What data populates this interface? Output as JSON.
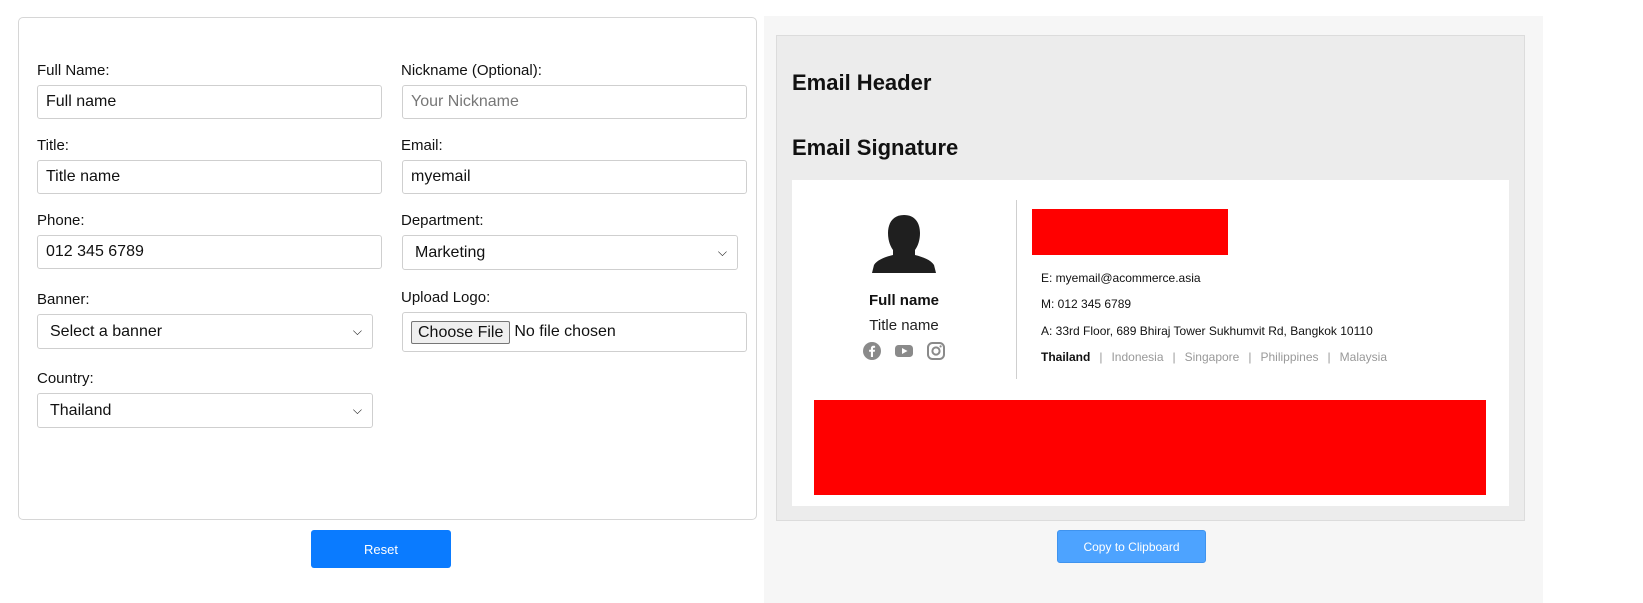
{
  "form": {
    "full_name": {
      "label": "Full Name:",
      "value": "Full name"
    },
    "nickname": {
      "label": "Nickname (Optional):",
      "placeholder": "Your Nickname"
    },
    "title": {
      "label": "Title:",
      "value": "Title name"
    },
    "email": {
      "label": "Email:",
      "value": "myemail"
    },
    "phone": {
      "label": "Phone:",
      "value": "012 345 6789"
    },
    "department": {
      "label": "Department:",
      "selected": "Marketing"
    },
    "banner": {
      "label": "Banner:",
      "selected": "Select a banner"
    },
    "logo": {
      "label": "Upload Logo:",
      "button": "Choose File",
      "status": "No file chosen"
    },
    "country": {
      "label": "Country:",
      "selected": "Thailand"
    },
    "reset_label": "Reset"
  },
  "preview": {
    "header_title": "Email Header",
    "signature_title": "Email Signature",
    "name": "Full name",
    "title": "Title name",
    "email_line": "E: myemail@acommerce.asia",
    "mobile_line": "M: 012 345 6789",
    "address_line": "A: 33rd Floor, 689 Bhiraj Tower Sukhumvit Rd, Bangkok 10110",
    "countries": [
      "Thailand",
      "Indonesia",
      "Singapore",
      "Philippines",
      "Malaysia"
    ],
    "active_country": "Thailand",
    "social_icons": [
      "facebook-icon",
      "youtube-icon",
      "instagram-icon"
    ],
    "placeholder_color": "#ff0000",
    "copy_label": "Copy to Clipboard"
  },
  "colors": {
    "primary": "#0a7bff",
    "copy_button": "#4da3ff",
    "placeholder_block": "#ff0000"
  }
}
